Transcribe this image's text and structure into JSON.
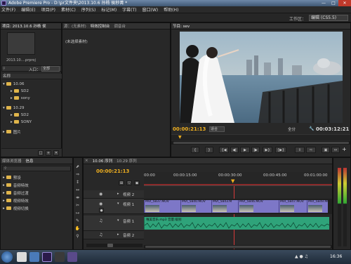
{
  "colors": {
    "timecode": "#f0b020",
    "playhead": "#d83a3a",
    "video_clip": "#7d77c7",
    "audio_clip": "#2fa37a",
    "folder": "#e0b54b",
    "accent": "#f0b020"
  },
  "app": {
    "title": "Adobe Premiere Pro - D:\\pr文件夹\\2013.10.6 孙杨 侯秒菁 *"
  },
  "menu": [
    "文件(F)",
    "编辑(E)",
    "项目(P)",
    "素材(C)",
    "序列(S)",
    "标记(M)",
    "字幕(T)",
    "窗口(W)",
    "帮助(H)"
  ],
  "workspace": {
    "label": "工作区：",
    "value": "编辑 (CS5.5)"
  },
  "project_panel": {
    "tab": "项目: 2013.10.6 孙杨 侯",
    "filename": "2013.10....prproj",
    "in_label": "入口：",
    "in_value": "全部",
    "col_name": "名称",
    "items": [
      {
        "label": "10.06",
        "indent": 0,
        "folder": true
      },
      {
        "label": "SD2",
        "indent": 1,
        "folder": true
      },
      {
        "label": "sony",
        "indent": 1,
        "folder": true
      },
      {
        "label": "10.29",
        "indent": 0,
        "folder": true
      },
      {
        "label": "SD2",
        "indent": 1,
        "folder": true
      },
      {
        "label": "SONY",
        "indent": 1,
        "folder": true
      },
      {
        "label": "图片",
        "indent": 0,
        "folder": true
      }
    ]
  },
  "source_panel": {
    "tabs": [
      "源：(无素材)",
      "特效控制台",
      "调音台"
    ],
    "content": "(未选择素材)"
  },
  "program_panel": {
    "tab": "节目: sev",
    "timecode_left": "00:00:21:13",
    "fit": "适合",
    "quality": "全分",
    "timecode_right": "00:03:12:21"
  },
  "media_browser": {
    "tabs": [
      "媒体浏览器",
      "信息"
    ],
    "items": [
      "预设",
      "音频特效",
      "音频过渡",
      "视频特效",
      "视频切换"
    ]
  },
  "timeline": {
    "tabs": [
      "10.06 序列",
      "10.29 序列"
    ],
    "timecode": "00:00:21:13",
    "ruler": [
      "00:00",
      "00:00:15:00",
      "00:00:30:00",
      "00:00:45:00",
      "00:01:00:00"
    ],
    "tracks": {
      "v2": "视频 2",
      "v1": "视频 1",
      "a1": "音频 1",
      "a2": "音频 2"
    },
    "video_clips": [
      "MVI_5837.MOV",
      "MVI_5840.MOV",
      "MVI_5843.M",
      "MVI_5846.MOV",
      "MVI_5847.MOV",
      "MVI_5849.MOV"
    ],
    "audio_clip": "唯美音乐.mp3  音量:级别"
  },
  "taskbar": {
    "time": "16:36"
  }
}
